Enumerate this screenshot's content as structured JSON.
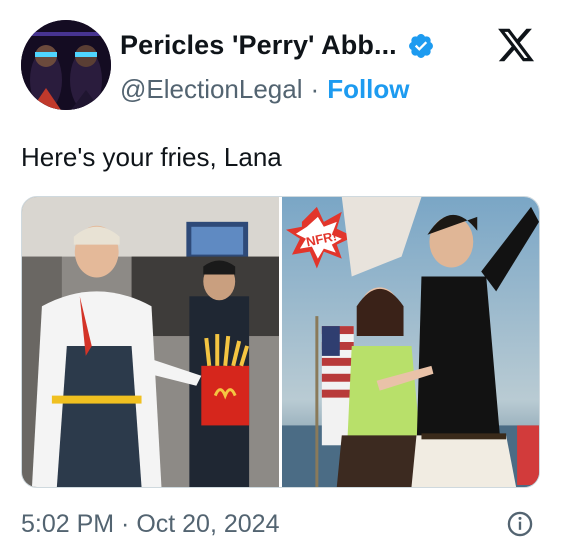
{
  "tweet": {
    "author": {
      "display_name": "Pericles 'Perry' Abb...",
      "handle": "@ElectionLegal",
      "separator": "·",
      "follow_label": "Follow",
      "verified": true
    },
    "text": "Here's your fries, Lana",
    "timestamp": "5:02 PM · Oct 20, 2024",
    "media": [
      {
        "name": "fries-photo",
        "icon": "photo-left"
      },
      {
        "name": "album-cover-photo",
        "icon": "photo-right",
        "overlay_text": "NFR!"
      }
    ]
  },
  "icons": {
    "verified": "verified-badge-icon",
    "platform": "x-logo-icon",
    "info": "info-icon"
  },
  "colors": {
    "accent": "#1d9bf0",
    "secondary_text": "#536471",
    "primary_text": "#0f1419"
  }
}
